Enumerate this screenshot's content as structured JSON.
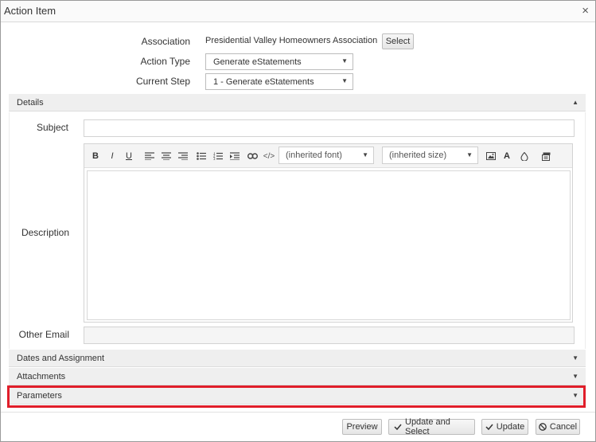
{
  "dialog": {
    "title": "Action Item",
    "close_icon": "close-icon",
    "close_glyph": "×"
  },
  "form": {
    "association_label": "Association",
    "association_value": "Presidential Valley Homeowners Association",
    "select_button": "Select",
    "action_type_label": "Action Type",
    "action_type_value": "Generate eStatements",
    "current_step_label": "Current Step",
    "current_step_value": "1 - Generate eStatements"
  },
  "details": {
    "header": "Details",
    "subject_label": "Subject",
    "subject_value": "",
    "description_label": "Description",
    "other_email_label": "Other Email",
    "other_email_value": "",
    "toolbar": {
      "bold": "B",
      "italic": "I",
      "underline": "U",
      "font_select": "(inherited font)",
      "size_select": "(inherited size)",
      "text_color": "A",
      "icons": [
        "align-left-icon",
        "align-center-icon",
        "align-right-icon",
        "bullet-list-icon",
        "numbered-list-icon",
        "indent-icon",
        "link-icon",
        "code-icon",
        "image-icon",
        "text-color-icon",
        "highlight-icon",
        "paste-icon"
      ]
    }
  },
  "sections": {
    "dates": "Dates and Assignment",
    "attachments": "Attachments",
    "parameters": "Parameters"
  },
  "buttons": {
    "preview": "Preview",
    "update_select": "Update and Select",
    "update": "Update",
    "cancel": "Cancel"
  },
  "colors": {
    "highlight": "#e01e2a",
    "section_bg": "#efefef"
  }
}
